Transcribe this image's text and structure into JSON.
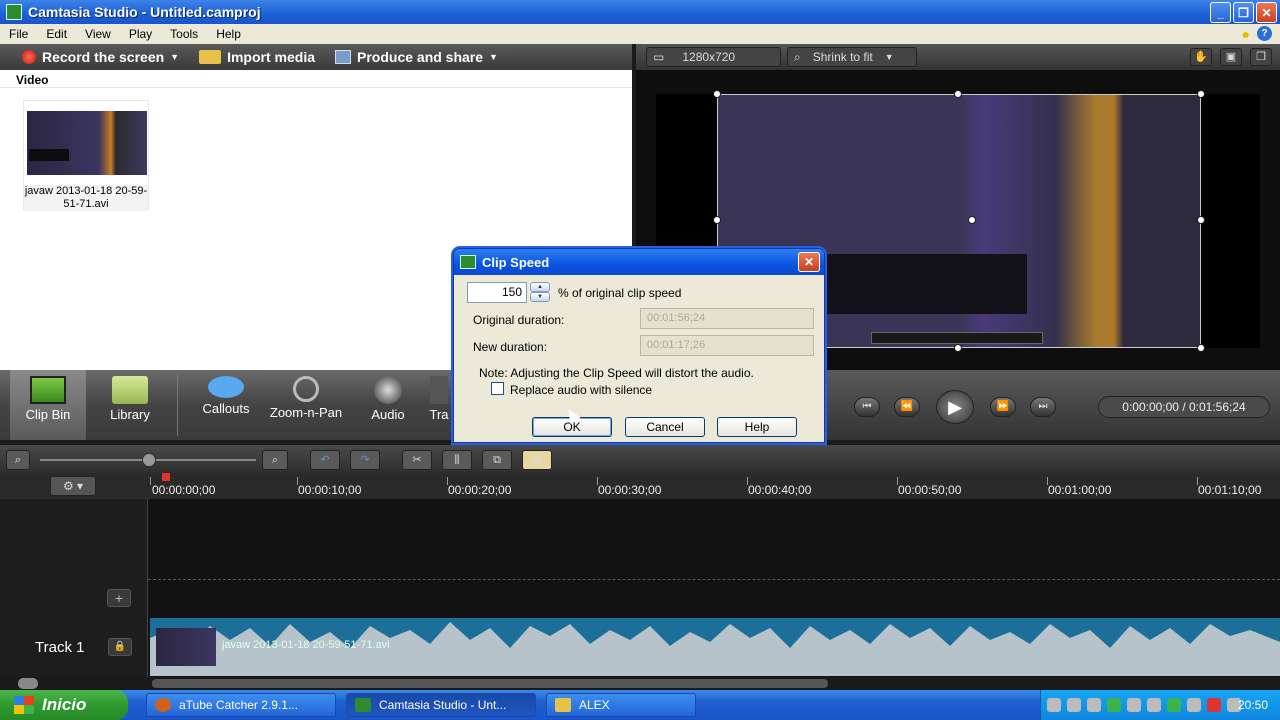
{
  "window": {
    "title": "Camtasia Studio - Untitled.camproj",
    "min": "_",
    "max": "❐",
    "close": "✕"
  },
  "menu": [
    "File",
    "Edit",
    "View",
    "Play",
    "Tools",
    "Help"
  ],
  "toolbar": {
    "record": "Record the screen",
    "import": "Import media",
    "produce": "Produce and share"
  },
  "clipbin": {
    "header": "Video",
    "clip_name": "javaw 2013-01-18 20-59-51-71.avi"
  },
  "preview": {
    "dimensions": "1280x720",
    "zoom": "Shrink to fit"
  },
  "tools": [
    "Clip Bin",
    "Library",
    "Callouts",
    "Zoom-n-Pan",
    "Audio",
    "Tra"
  ],
  "transport": {
    "timecode": "0:00:00;00 / 0:01:56;24"
  },
  "ruler": [
    "00:00:00;00",
    "00:00:10;00",
    "00:00:20;00",
    "00:00:30;00",
    "00:00:40;00",
    "00:00:50;00",
    "00:01:00;00",
    "00:01:10;00"
  ],
  "timeline": {
    "track_label": "Track 1",
    "clip_label": "javaw 2013-01-18 20-59-51-71.avi"
  },
  "dialog": {
    "title": "Clip Speed",
    "speed_value": "150",
    "speed_suffix": "% of original clip speed",
    "orig_label": "Original duration:",
    "orig_value": "00:01:56;24",
    "new_label": "New duration:",
    "new_value": "00:01:17;26",
    "note": "Note: Adjusting the Clip Speed will distort the audio.",
    "checkbox_label": "Replace audio with silence",
    "ok": "OK",
    "cancel": "Cancel",
    "help": "Help"
  },
  "taskbar": {
    "start": "Inicio",
    "tasks": [
      "aTube Catcher 2.9.1...",
      "Camtasia Studio - Unt...",
      "ALEX"
    ],
    "clock": "20:50"
  },
  "colors": {
    "accent": "#1c5fd6",
    "clip": "#1b6f99",
    "record": "#c81a0a"
  }
}
